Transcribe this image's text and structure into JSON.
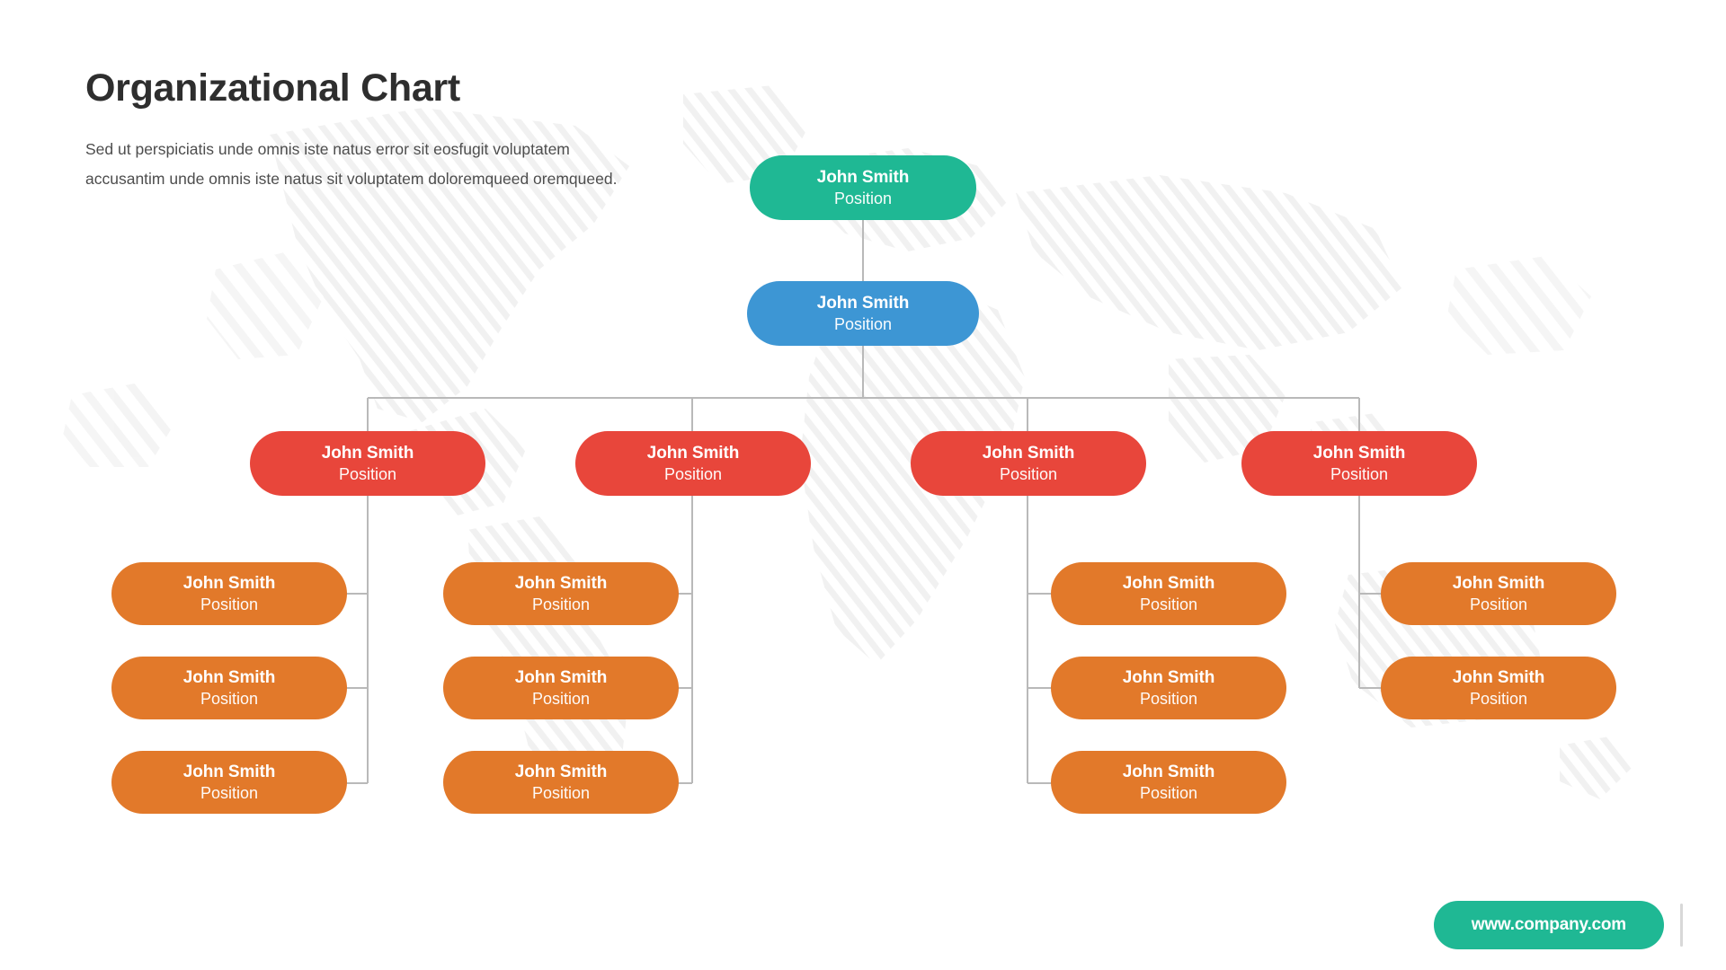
{
  "header": {
    "title": "Organizational Chart",
    "paragraph": "Sed ut perspiciatis unde omnis iste natus error sit eosfugit voluptatem accusantim unde omnis iste natus sit voluptatem doloremqueed oremqueed."
  },
  "colors": {
    "ceo": "#1fb894",
    "department": "#3d96d4",
    "manager": "#e8463b",
    "team": "#e2792a",
    "connector": "#b9b9b9",
    "title": "#2e2e2e",
    "body_text": "#4d4d4d",
    "map": "#f0f0f0",
    "footer": "#1fb894"
  },
  "chart_data": {
    "type": "diagram",
    "title": "Organizational Chart",
    "levels": [
      "ceo",
      "department",
      "manager",
      "team"
    ],
    "nodes": {
      "ceo": {
        "name": "John Smith",
        "position": "Position",
        "color": "#1fb894"
      },
      "department": {
        "name": "John Smith",
        "position": "Position",
        "color": "#3d96d4"
      },
      "managers": [
        {
          "name": "John Smith",
          "position": "Position",
          "color": "#e8463b"
        },
        {
          "name": "John Smith",
          "position": "Position",
          "color": "#e8463b"
        },
        {
          "name": "John Smith",
          "position": "Position",
          "color": "#e8463b"
        },
        {
          "name": "John Smith",
          "position": "Position",
          "color": "#e8463b"
        }
      ],
      "teams": [
        [
          {
            "name": "John Smith",
            "position": "Position",
            "color": "#e2792a"
          },
          {
            "name": "John Smith",
            "position": "Position",
            "color": "#e2792a"
          },
          {
            "name": "John Smith",
            "position": "Position",
            "color": "#e2792a"
          }
        ],
        [
          {
            "name": "John Smith",
            "position": "Position",
            "color": "#e2792a"
          },
          {
            "name": "John Smith",
            "position": "Position",
            "color": "#e2792a"
          },
          {
            "name": "John Smith",
            "position": "Position",
            "color": "#e2792a"
          }
        ],
        [
          {
            "name": "John Smith",
            "position": "Position",
            "color": "#e2792a"
          },
          {
            "name": "John Smith",
            "position": "Position",
            "color": "#e2792a"
          },
          {
            "name": "John Smith",
            "position": "Position",
            "color": "#e2792a"
          }
        ],
        [
          {
            "name": "John Smith",
            "position": "Position",
            "color": "#e2792a"
          },
          {
            "name": "John Smith",
            "position": "Position",
            "color": "#e2792a"
          }
        ]
      ]
    },
    "counts": {
      "ceo": 1,
      "department": 1,
      "managers": 4,
      "teams": [
        3,
        3,
        3,
        2
      ],
      "total": 17
    }
  },
  "footer": {
    "website": "www.company.com"
  }
}
